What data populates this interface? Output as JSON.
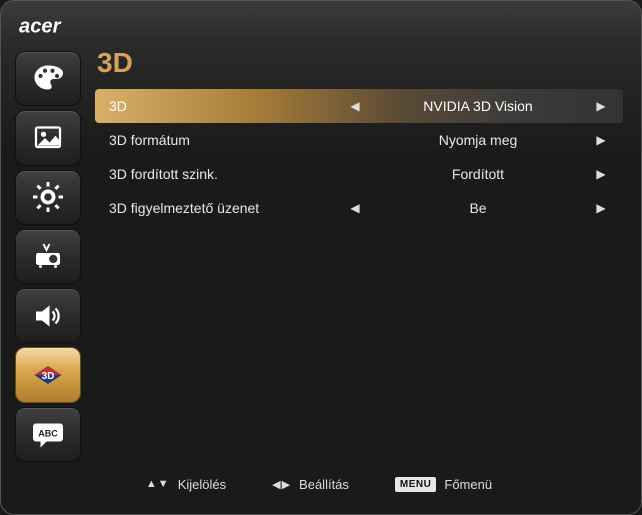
{
  "brand": "acer",
  "page": {
    "title": "3D"
  },
  "sidebar": {
    "items": [
      {
        "name": "color-icon"
      },
      {
        "name": "image-icon"
      },
      {
        "name": "settings-icon"
      },
      {
        "name": "management-icon"
      },
      {
        "name": "audio-icon"
      },
      {
        "name": "3d-icon",
        "active": true
      },
      {
        "name": "language-icon"
      }
    ]
  },
  "rows": [
    {
      "label": "3D",
      "value": "NVIDIA 3D Vision",
      "left": true,
      "right": true,
      "selected": true
    },
    {
      "label": "3D formátum",
      "value": "Nyomja meg",
      "left": false,
      "right": true,
      "selected": false
    },
    {
      "label": "3D fordított szink.",
      "value": "Fordított",
      "left": false,
      "right": true,
      "selected": false
    },
    {
      "label": "3D figyelmeztető üzenet",
      "value": "Be",
      "left": true,
      "right": true,
      "selected": false
    }
  ],
  "footer": {
    "select_label": "Kijelölés",
    "adjust_label": "Beállítás",
    "menu_badge": "MENU",
    "menu_label": "Főmenü"
  }
}
